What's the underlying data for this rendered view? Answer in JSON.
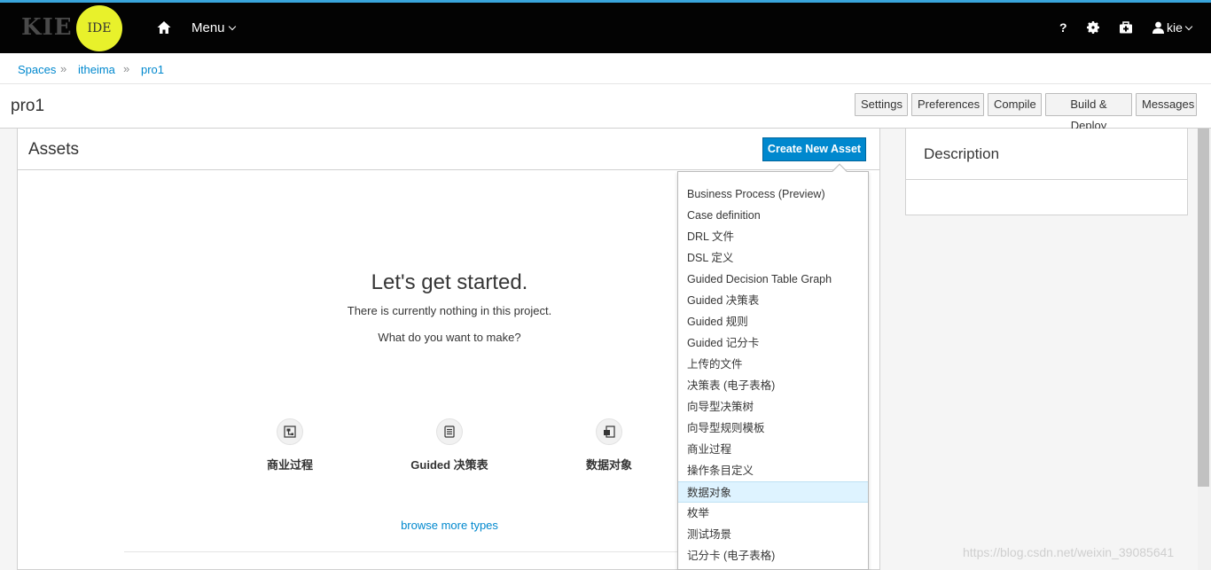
{
  "header": {
    "logo_text": "KIE",
    "logo_badge": "IDE",
    "menu_label": "Menu",
    "help_label": "?",
    "user_label": "kie"
  },
  "breadcrumb": {
    "items": [
      "Spaces",
      "itheima",
      "pro1"
    ],
    "separator": "»"
  },
  "project": {
    "title": "pro1",
    "actions": [
      "Settings",
      "Preferences",
      "Compile",
      "Build & Deploy",
      "Messages"
    ]
  },
  "assets": {
    "title": "Assets",
    "create_button": "Create New Asset",
    "empty_title": "Let's get started.",
    "empty_line1": "There is currently nothing in this project.",
    "empty_line2": "What do you want to make?",
    "quick_types": [
      "商业过程",
      "Guided 决策表",
      "数据对象"
    ],
    "browse_link": "browse more types"
  },
  "asset_menu": {
    "items": [
      "Business Process (Preview)",
      "Case definition",
      "DRL 文件",
      "DSL 定义",
      "Guided Decision Table Graph",
      "Guided 决策表",
      "Guided 规则",
      "Guided 记分卡",
      "上传的文件",
      "决策表 (电子表格)",
      "向导型决策树",
      "向导型规则模板",
      "商业过程",
      "操作条目定义",
      "数据对象",
      "枚举",
      "测试场景",
      "记分卡 (电子表格)"
    ],
    "highlighted": "数据对象"
  },
  "description": {
    "title": "Description"
  },
  "watermark": "https://blog.csdn.net/weixin_39085641",
  "colors": {
    "accent": "#0088ce",
    "topbar": "#030303",
    "logo_badge": "#e8f12b",
    "highlight": "#def3ff"
  }
}
